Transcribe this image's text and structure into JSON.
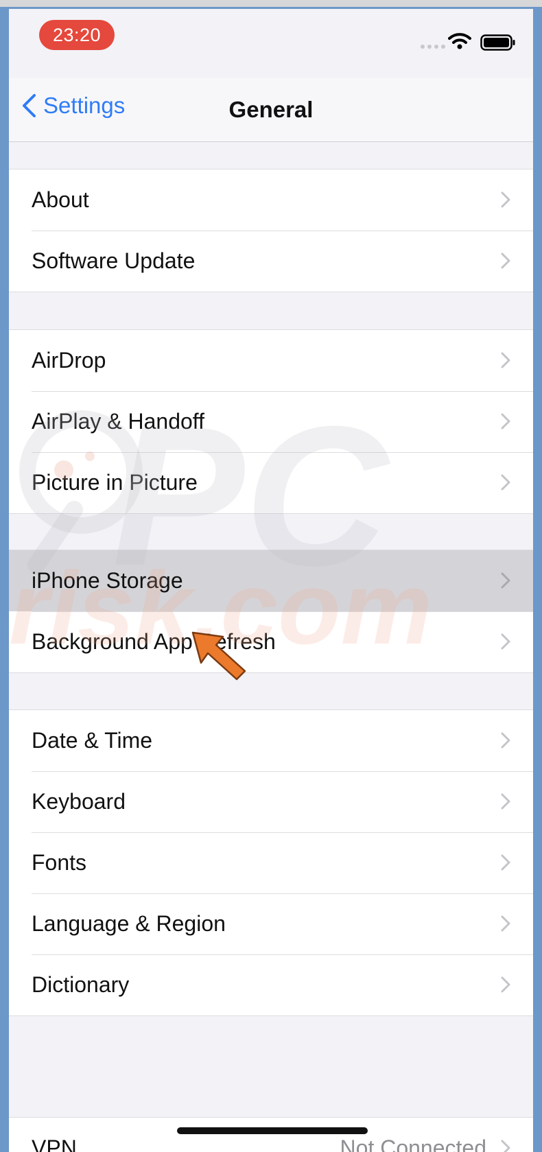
{
  "status_bar": {
    "time": "23:20"
  },
  "nav": {
    "back_label": "Settings",
    "title": "General"
  },
  "groups": [
    {
      "items": [
        {
          "label": "About"
        },
        {
          "label": "Software Update"
        }
      ]
    },
    {
      "items": [
        {
          "label": "AirDrop"
        },
        {
          "label": "AirPlay & Handoff"
        },
        {
          "label": "Picture in Picture"
        }
      ]
    },
    {
      "items": [
        {
          "label": "iPhone Storage",
          "highlighted": true
        },
        {
          "label": "Background App Refresh"
        }
      ]
    },
    {
      "items": [
        {
          "label": "Date & Time"
        },
        {
          "label": "Keyboard"
        },
        {
          "label": "Fonts"
        },
        {
          "label": "Language & Region"
        },
        {
          "label": "Dictionary"
        }
      ]
    },
    {
      "items": [
        {
          "label": "VPN",
          "value": "Not Connected"
        }
      ]
    }
  ],
  "watermark": {
    "text": "PC risk.com"
  },
  "colors": {
    "accent": "#2f7cf6",
    "time_pill": "#e5483c",
    "pointer": "#ec7a2c",
    "page_bg": "#6c97c9"
  }
}
